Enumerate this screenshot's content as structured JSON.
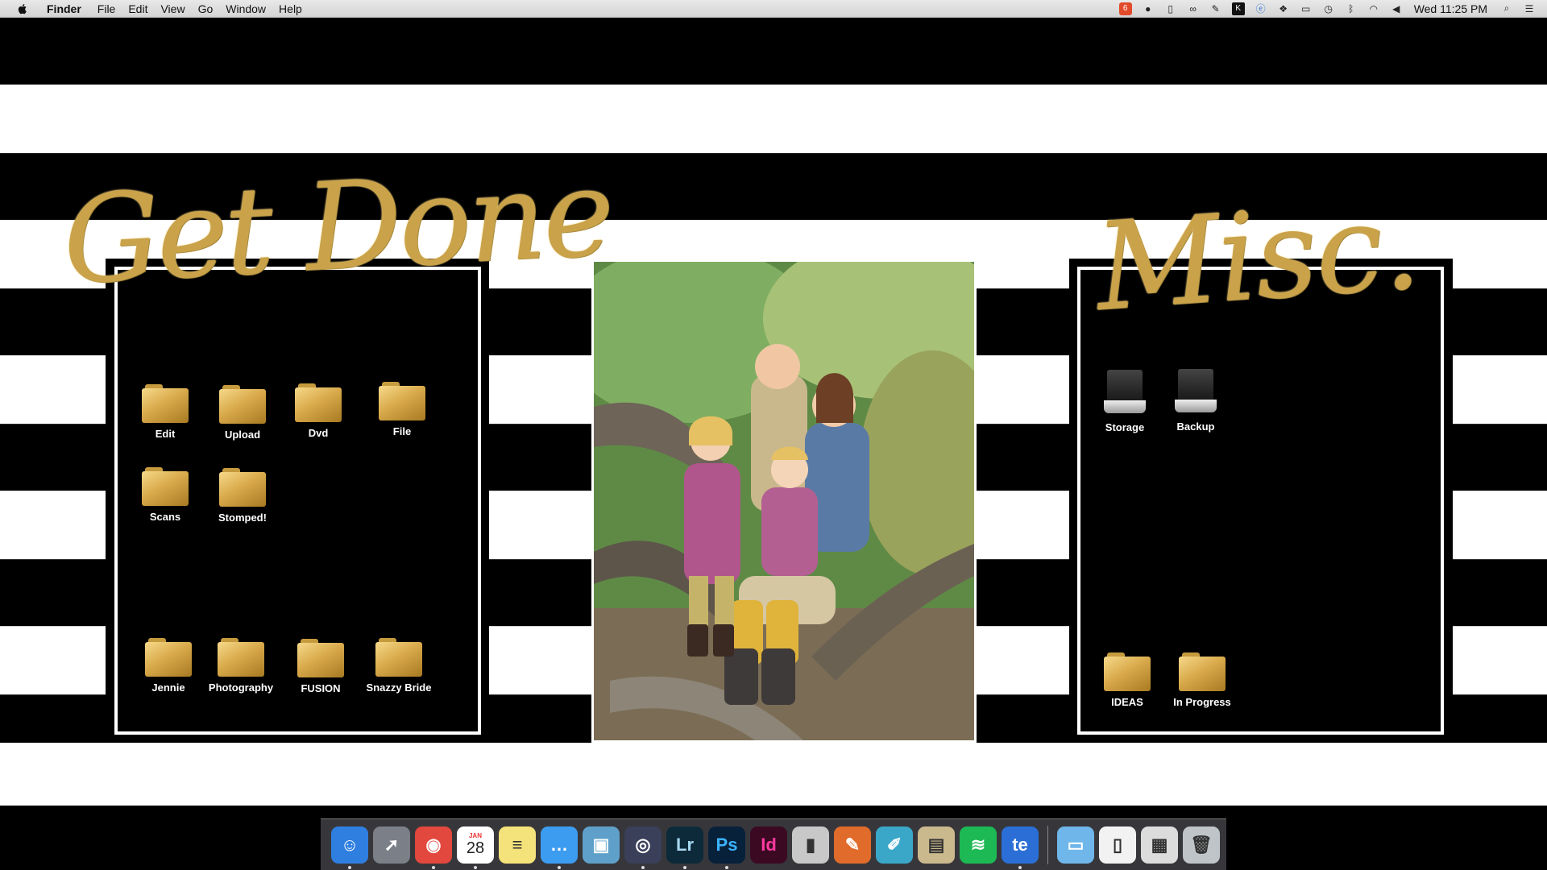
{
  "menubar": {
    "app_name": "Finder",
    "menus": [
      "File",
      "Edit",
      "View",
      "Go",
      "Window",
      "Help"
    ],
    "clock": "Wed 11:25 PM",
    "status_icons": [
      "app-badge-icon",
      "speech-bubble-icon",
      "battery-device-icon",
      "creative-cloud-icon",
      "evernote-icon",
      "kindle-icon",
      "te-icon",
      "dropbox-icon",
      "airplay-icon",
      "time-machine-icon",
      "bluetooth-icon",
      "wifi-icon",
      "volume-icon",
      "spotlight-icon",
      "notification-center-icon"
    ]
  },
  "panels": {
    "left_title": "Get Done",
    "right_title": "Misc."
  },
  "left_folders": [
    {
      "label": "Edit"
    },
    {
      "label": "Upload"
    },
    {
      "label": "Dvd"
    },
    {
      "label": "File"
    },
    {
      "label": "Scans"
    },
    {
      "label": "Stomped!"
    },
    {
      "label": "Jennie"
    },
    {
      "label": "Photography"
    },
    {
      "label": "FUSION"
    },
    {
      "label": "Snazzy Bride"
    }
  ],
  "right_drives": [
    {
      "label": "Storage"
    },
    {
      "label": "Backup"
    }
  ],
  "right_folders": [
    {
      "label": "IDEAS"
    },
    {
      "label": "In Progress"
    }
  ],
  "calendar_date": "28",
  "calendar_month": "JAN",
  "dock": {
    "apps": [
      {
        "name": "finder-icon",
        "color": "#2f7fe0",
        "glyph": "☺",
        "running": true
      },
      {
        "name": "launchpad-icon",
        "color": "#7a7f88",
        "glyph": "➚",
        "running": false
      },
      {
        "name": "chrome-icon",
        "color": "#e2483d",
        "glyph": "◉",
        "running": true
      },
      {
        "name": "calendar-icon",
        "color": "#ffffff",
        "glyph": "",
        "running": true
      },
      {
        "name": "notes-icon",
        "color": "#f4e27a",
        "glyph": "≡",
        "running": false
      },
      {
        "name": "messages-icon",
        "color": "#3c9cf0",
        "glyph": "…",
        "running": true
      },
      {
        "name": "iphoto-icon",
        "color": "#5ea0c9",
        "glyph": "▣",
        "running": false
      },
      {
        "name": "aperture-icon",
        "color": "#3a3f5a",
        "glyph": "◎",
        "running": true
      },
      {
        "name": "lightroom-icon",
        "color": "#0d2a3a",
        "glyph": "Lr",
        "running": true
      },
      {
        "name": "photoshop-icon",
        "color": "#08213b",
        "glyph": "Ps",
        "running": true
      },
      {
        "name": "indesign-icon",
        "color": "#3b0a22",
        "glyph": "Id",
        "running": false
      },
      {
        "name": "diet-coke-icon",
        "color": "#c8c8c8",
        "glyph": "▮",
        "running": false
      },
      {
        "name": "ibooks-author-icon",
        "color": "#e06b2a",
        "glyph": "✎",
        "running": false
      },
      {
        "name": "pages-icon",
        "color": "#3aa7c9",
        "glyph": "✐",
        "running": false
      },
      {
        "name": "archive-box-icon",
        "color": "#cbb98e",
        "glyph": "▤",
        "running": false
      },
      {
        "name": "spotify-icon",
        "color": "#1db954",
        "glyph": "≋",
        "running": false
      },
      {
        "name": "te-app-icon",
        "color": "#2b6fd6",
        "glyph": "te",
        "running": true
      }
    ],
    "right_items": [
      {
        "name": "applications-folder-icon",
        "color": "#6fb6ea",
        "glyph": "▭"
      },
      {
        "name": "documents-icon",
        "color": "#f2f2f2",
        "glyph": "▯"
      },
      {
        "name": "downloads-stack-icon",
        "color": "#dcdcdc",
        "glyph": "▦"
      },
      {
        "name": "trash-icon",
        "color": "#bfc4c8",
        "glyph": "🗑"
      }
    ]
  }
}
